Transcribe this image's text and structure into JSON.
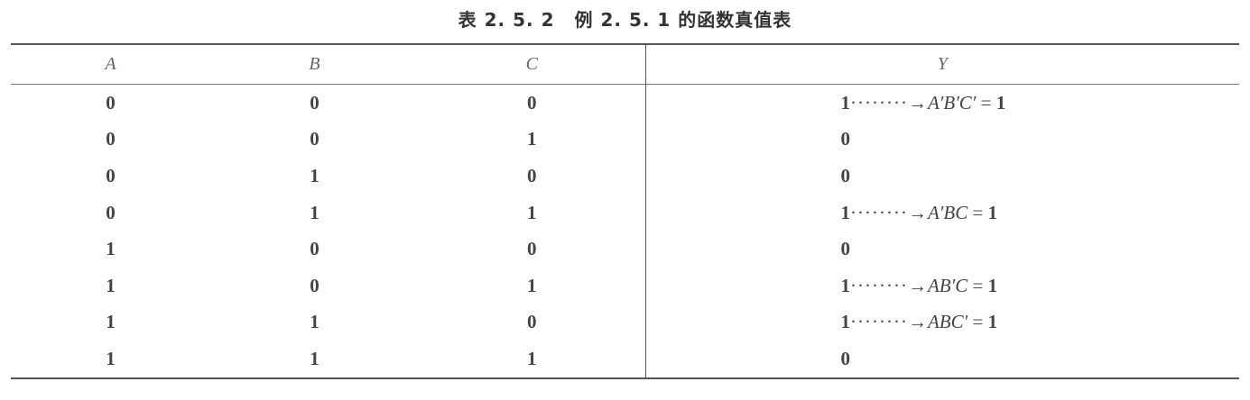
{
  "caption": {
    "label": "表 2. 5. 2",
    "title": "例 2. 5. 1 的函数真值表"
  },
  "headers": {
    "a": "A",
    "b": "B",
    "c": "C",
    "y": "Y"
  },
  "rows": [
    {
      "a": "0",
      "b": "0",
      "c": "0",
      "y": "1",
      "dots": "········→",
      "expr": "A′B′C′",
      "eq": " = ",
      "result": "1"
    },
    {
      "a": "0",
      "b": "0",
      "c": "1",
      "y": "0"
    },
    {
      "a": "0",
      "b": "1",
      "c": "0",
      "y": "0"
    },
    {
      "a": "0",
      "b": "1",
      "c": "1",
      "y": "1",
      "dots": "········→",
      "expr": "A′BC",
      "eq": " = ",
      "result": "1"
    },
    {
      "a": "1",
      "b": "0",
      "c": "0",
      "y": "0"
    },
    {
      "a": "1",
      "b": "0",
      "c": "1",
      "y": "1",
      "dots": "········→",
      "expr": "AB′C",
      "eq": " = ",
      "result": "1"
    },
    {
      "a": "1",
      "b": "1",
      "c": "0",
      "y": "1",
      "dots": "········→",
      "expr": "ABC′",
      "eq": " = ",
      "result": "1"
    },
    {
      "a": "1",
      "b": "1",
      "c": "1",
      "y": "0"
    }
  ]
}
